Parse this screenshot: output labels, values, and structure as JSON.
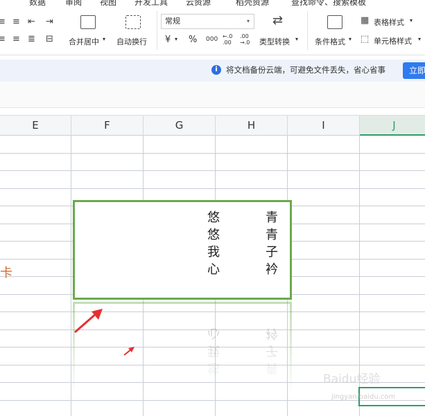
{
  "ribbon": {
    "top_tabs": [
      "数据",
      "审阅",
      "视图",
      "开发工具",
      "云资源",
      "稻壳资源",
      "查找命令、搜索模板"
    ],
    "merge_center": "合并居中",
    "wrap_text": "自动换行",
    "number_format": "常规",
    "currency_symbol": "¥",
    "percent_symbol": "%",
    "thousands_symbol": "000",
    "increase_decimal": "←.0 .00",
    "decrease_decimal": ".00 →.0",
    "type_convert": "类型转换",
    "conditional_format": "条件格式",
    "table_style": "表格样式",
    "cell_style": "单元格样式"
  },
  "notice": {
    "message": "将文档备份云端，可避免文件丢失，省心省事",
    "button": "立即"
  },
  "columns": [
    "E",
    "F",
    "G",
    "H",
    "I",
    "J"
  ],
  "selected_column": "J",
  "cell_fragment": "卡",
  "textbox": {
    "left_column_chars": [
      "悠",
      "悠",
      "我",
      "心"
    ],
    "right_column_chars": [
      "青",
      "青",
      "子",
      "衿"
    ]
  },
  "watermark": "Baidu经验",
  "watermark_url": "jingyan.baidu.com",
  "colors": {
    "accent_green": "#2e9d6a",
    "textbox_border": "#6aaa4e",
    "notice_bg": "#eef3fb",
    "button_blue": "#2f7bf0",
    "arrow_red": "#e63030"
  }
}
